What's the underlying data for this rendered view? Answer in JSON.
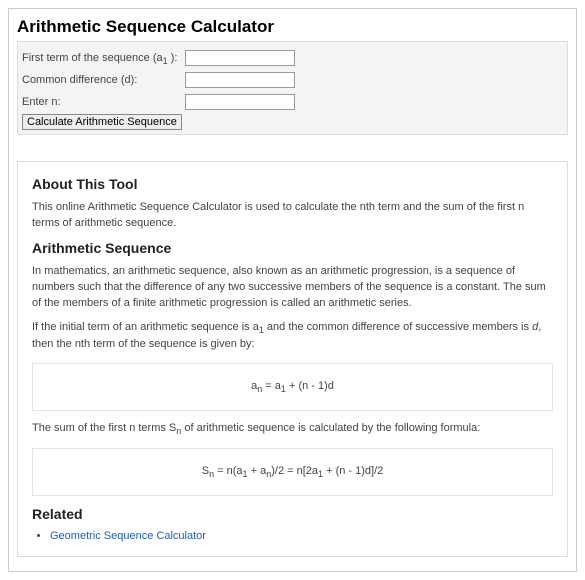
{
  "title": "Arithmetic Sequence Calculator",
  "form": {
    "first_term_label_pre": "First term of the sequence (a",
    "first_term_label_sub": "1",
    "first_term_label_post": " ):",
    "common_diff_label": "Common difference (d):",
    "enter_n_label": "Enter n:",
    "first_term_value": "",
    "common_diff_value": "",
    "n_value": "",
    "button_label": "Calculate Arithmetic Sequence"
  },
  "about": {
    "heading": "About This Tool",
    "intro": "This online Arithmetic Sequence Calculator is used to calculate the nth term and the sum of the first n terms of arithmetic sequence."
  },
  "seq": {
    "heading": "Arithmetic Sequence",
    "p1": "In mathematics, an arithmetic sequence, also known as an arithmetic progression, is a sequence of numbers such that the difference of any two successive members of the sequence is a constant. The sum of the members of a finite arithmetic progression is called an arithmetic series.",
    "p2_pre": "If the initial term of an arithmetic sequence is a",
    "p2_sub": "1",
    "p2_mid": " and the common difference of successive members is ",
    "p2_d": "d",
    "p2_post": ", then the nth term of the sequence is given by:"
  },
  "formula1": {
    "a": "a",
    "nsub": "n",
    "eq": " = a",
    "onesub": "1",
    "rest": " + (n - 1)d"
  },
  "sumline": {
    "pre": "The sum of the first n terms S",
    "sub": "n",
    "post": " of arithmetic sequence is calculated by the following formula:"
  },
  "formula2": {
    "s": "S",
    "nsub": "n",
    "p1": " = n(a",
    "sub1": "1",
    "p2": " + a",
    "subn": "n",
    "p3": ")/2 = n[2a",
    "sub1b": "1",
    "p4": " + (n - 1)d]/2"
  },
  "related": {
    "heading": "Related",
    "link": "Geometric Sequence Calculator"
  }
}
